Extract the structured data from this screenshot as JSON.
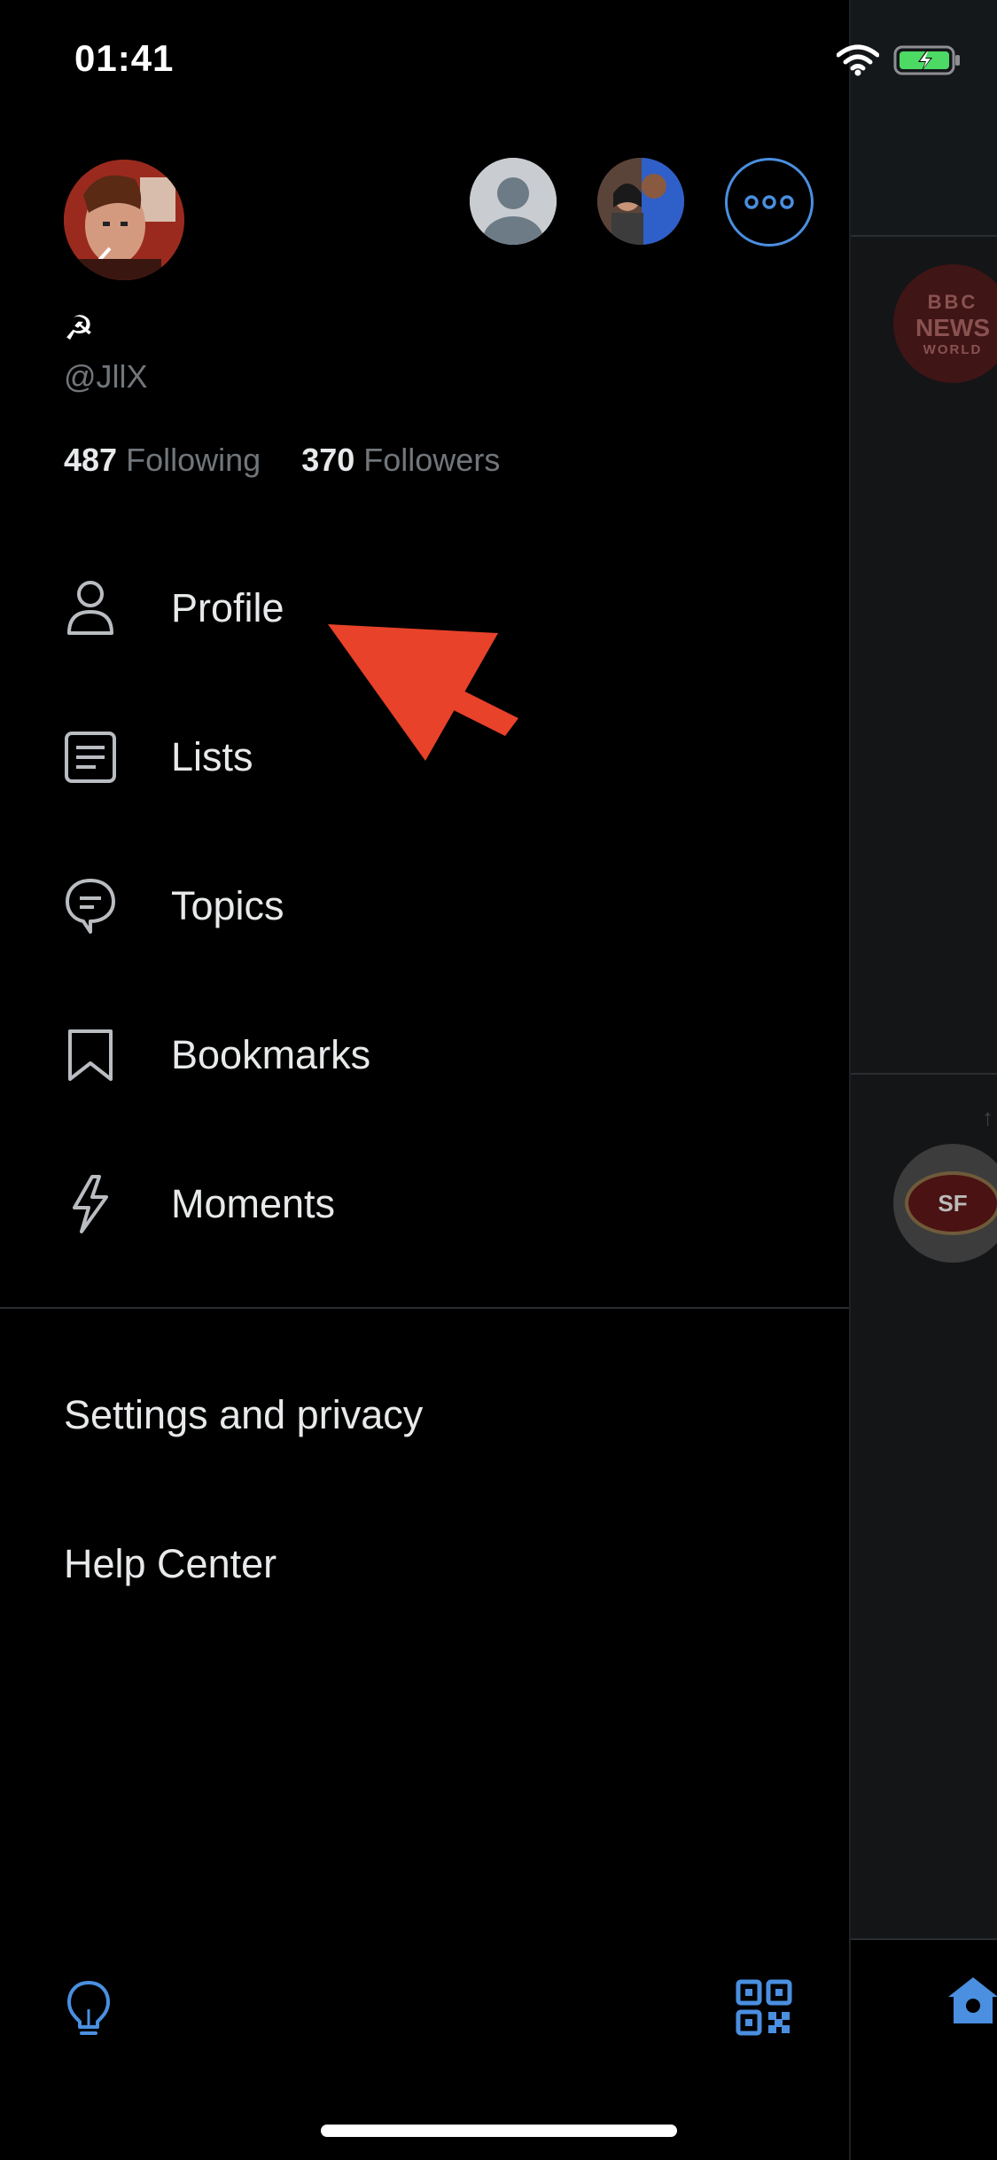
{
  "status_bar": {
    "time": "01:41",
    "battery_color": "#4cd964"
  },
  "account": {
    "name": "☭",
    "handle": "@JllX",
    "following_count": "487",
    "following_label": "Following",
    "followers_count": "370",
    "followers_label": "Followers"
  },
  "menu": {
    "items": [
      {
        "label": "Profile",
        "icon": "person-icon"
      },
      {
        "label": "Lists",
        "icon": "list-icon"
      },
      {
        "label": "Topics",
        "icon": "topics-icon"
      },
      {
        "label": "Bookmarks",
        "icon": "bookmark-icon"
      },
      {
        "label": "Moments",
        "icon": "lightning-icon"
      }
    ]
  },
  "secondary": {
    "settings_label": "Settings and privacy",
    "help_label": "Help Center"
  },
  "background": {
    "bbc_line1": "BBC",
    "bbc_line2": "NEWS",
    "bbc_line3": "WORLD",
    "niners_label": "SF"
  },
  "colors": {
    "accent": "#4a8fe0",
    "annotation_arrow": "#e8422a",
    "text_primary": "#e7e9ea",
    "text_secondary": "#71767b"
  }
}
